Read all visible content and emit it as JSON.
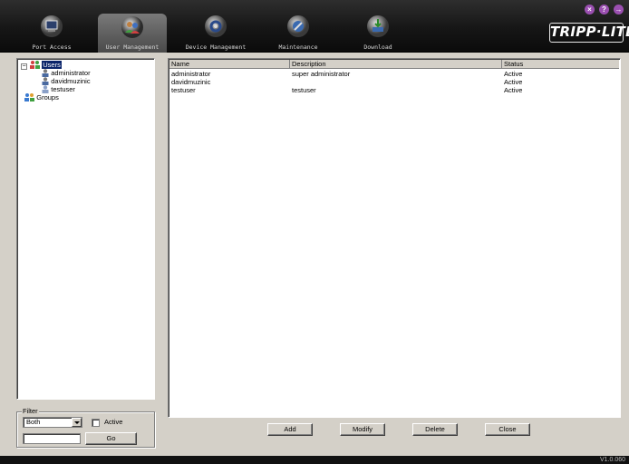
{
  "tabs": [
    {
      "label": "Port Access",
      "icon": "port-access-icon"
    },
    {
      "label": "User Management",
      "icon": "user-management-icon",
      "active": true
    },
    {
      "label": "Device Management",
      "icon": "device-management-icon"
    },
    {
      "label": "Maintenance",
      "icon": "maintenance-icon"
    },
    {
      "label": "Download",
      "icon": "download-icon"
    }
  ],
  "window_buttons": {
    "close": "×",
    "help": "?",
    "logout": "→"
  },
  "brand": {
    "logo_text": "TRIPP·LITE",
    "accent": "#5a5aa8"
  },
  "tree": {
    "users_label": "Users",
    "users": [
      "administrator",
      "davidmuzinic",
      "testuser"
    ],
    "groups_label": "Groups",
    "expander": "−"
  },
  "table": {
    "columns": [
      "Name",
      "Description",
      "Status"
    ],
    "rows": [
      [
        "administrator",
        "super administrator",
        "Active"
      ],
      [
        "davidmuzinic",
        "",
        "Active"
      ],
      [
        "testuser",
        "testuser",
        "Active"
      ]
    ]
  },
  "filter": {
    "legend": "Filter",
    "select_value": "Both",
    "active_label": "Active",
    "input_value": "",
    "go_label": "Go"
  },
  "actions": {
    "add": "Add",
    "modify": "Modify",
    "delete": "Delete",
    "close": "Close"
  },
  "footer": {
    "version": "V1.0.060"
  }
}
